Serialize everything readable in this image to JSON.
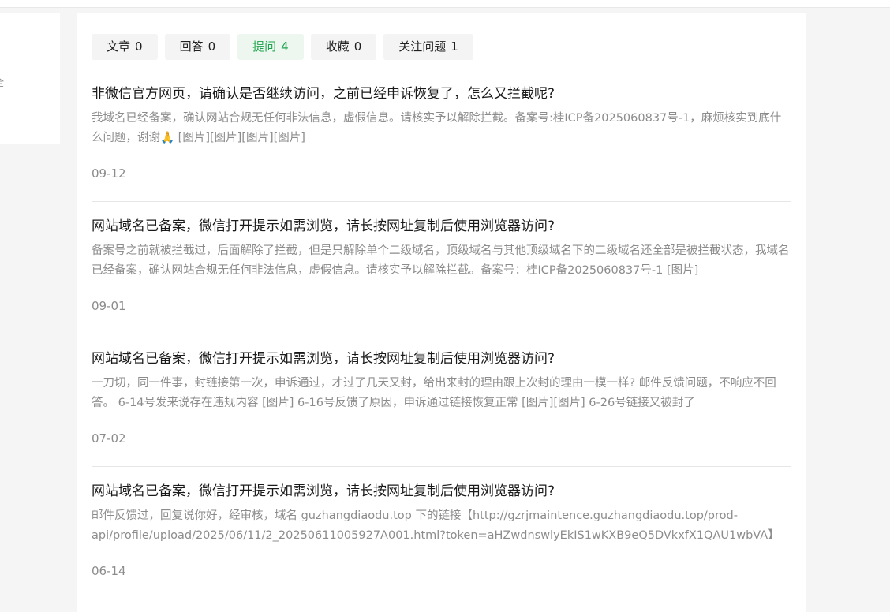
{
  "left_panel": {
    "edge_text": "全"
  },
  "tabs": [
    {
      "label": "文章",
      "count": "0",
      "active": false
    },
    {
      "label": "回答",
      "count": "0",
      "active": false
    },
    {
      "label": "提问",
      "count": "4",
      "active": true
    },
    {
      "label": "收藏",
      "count": "0",
      "active": false
    },
    {
      "label": "关注问题",
      "count": "1",
      "active": false
    }
  ],
  "items": [
    {
      "title": "非微信官方网页，请确认是否继续访问，之前已经申诉恢复了，怎么又拦截呢?",
      "excerpt": "我域名已经备案，确认网站合规无任何非法信息，虚假信息。请核实予以解除拦截。备案号:桂ICP备2025060837号-1，麻烦核实到底什么问题，谢谢🙏 [图片][图片][图片][图片]",
      "date": "09-12"
    },
    {
      "title": "网站域名已备案，微信打开提示如需浏览，请长按网址复制后使用浏览器访问?",
      "excerpt": "备案号之前就被拦截过，后面解除了拦截，但是只解除单个二级域名，顶级域名与其他顶级域名下的二级域名还全部是被拦截状态，我域名已经备案，确认网站合规无任何非法信息，虚假信息。请核实予以解除拦截。备案号：桂ICP备2025060837号-1 [图片]",
      "date": "09-01"
    },
    {
      "title": "网站域名已备案，微信打开提示如需浏览，请长按网址复制后使用浏览器访问?",
      "excerpt": "一刀切，同一件事，封链接第一次，申诉通过，才过了几天又封，给出来封的理由跟上次封的理由一模一样? 邮件反馈问题，不响应不回答。 6-14号发来说存在违规内容 [图片] 6-16号反馈了原因，申诉通过链接恢复正常 [图片][图片] 6-26号链接又被封了",
      "date": "07-02"
    },
    {
      "title": "网站域名已备案，微信打开提示如需浏览，请长按网址复制后使用浏览器访问?",
      "excerpt": "邮件反馈过，回复说你好，经审核，域名 guzhangdiaodu.top 下的链接【http://gzrjmaintence.guzhangdiaodu.top/prod-api/profile/upload/2025/06/11/2_20250611005927A001.html?token=aHZwdnswlyEkIS1wKXB9eQ5DVkxfX1QAU1wbVA】",
      "date": "06-14"
    }
  ]
}
